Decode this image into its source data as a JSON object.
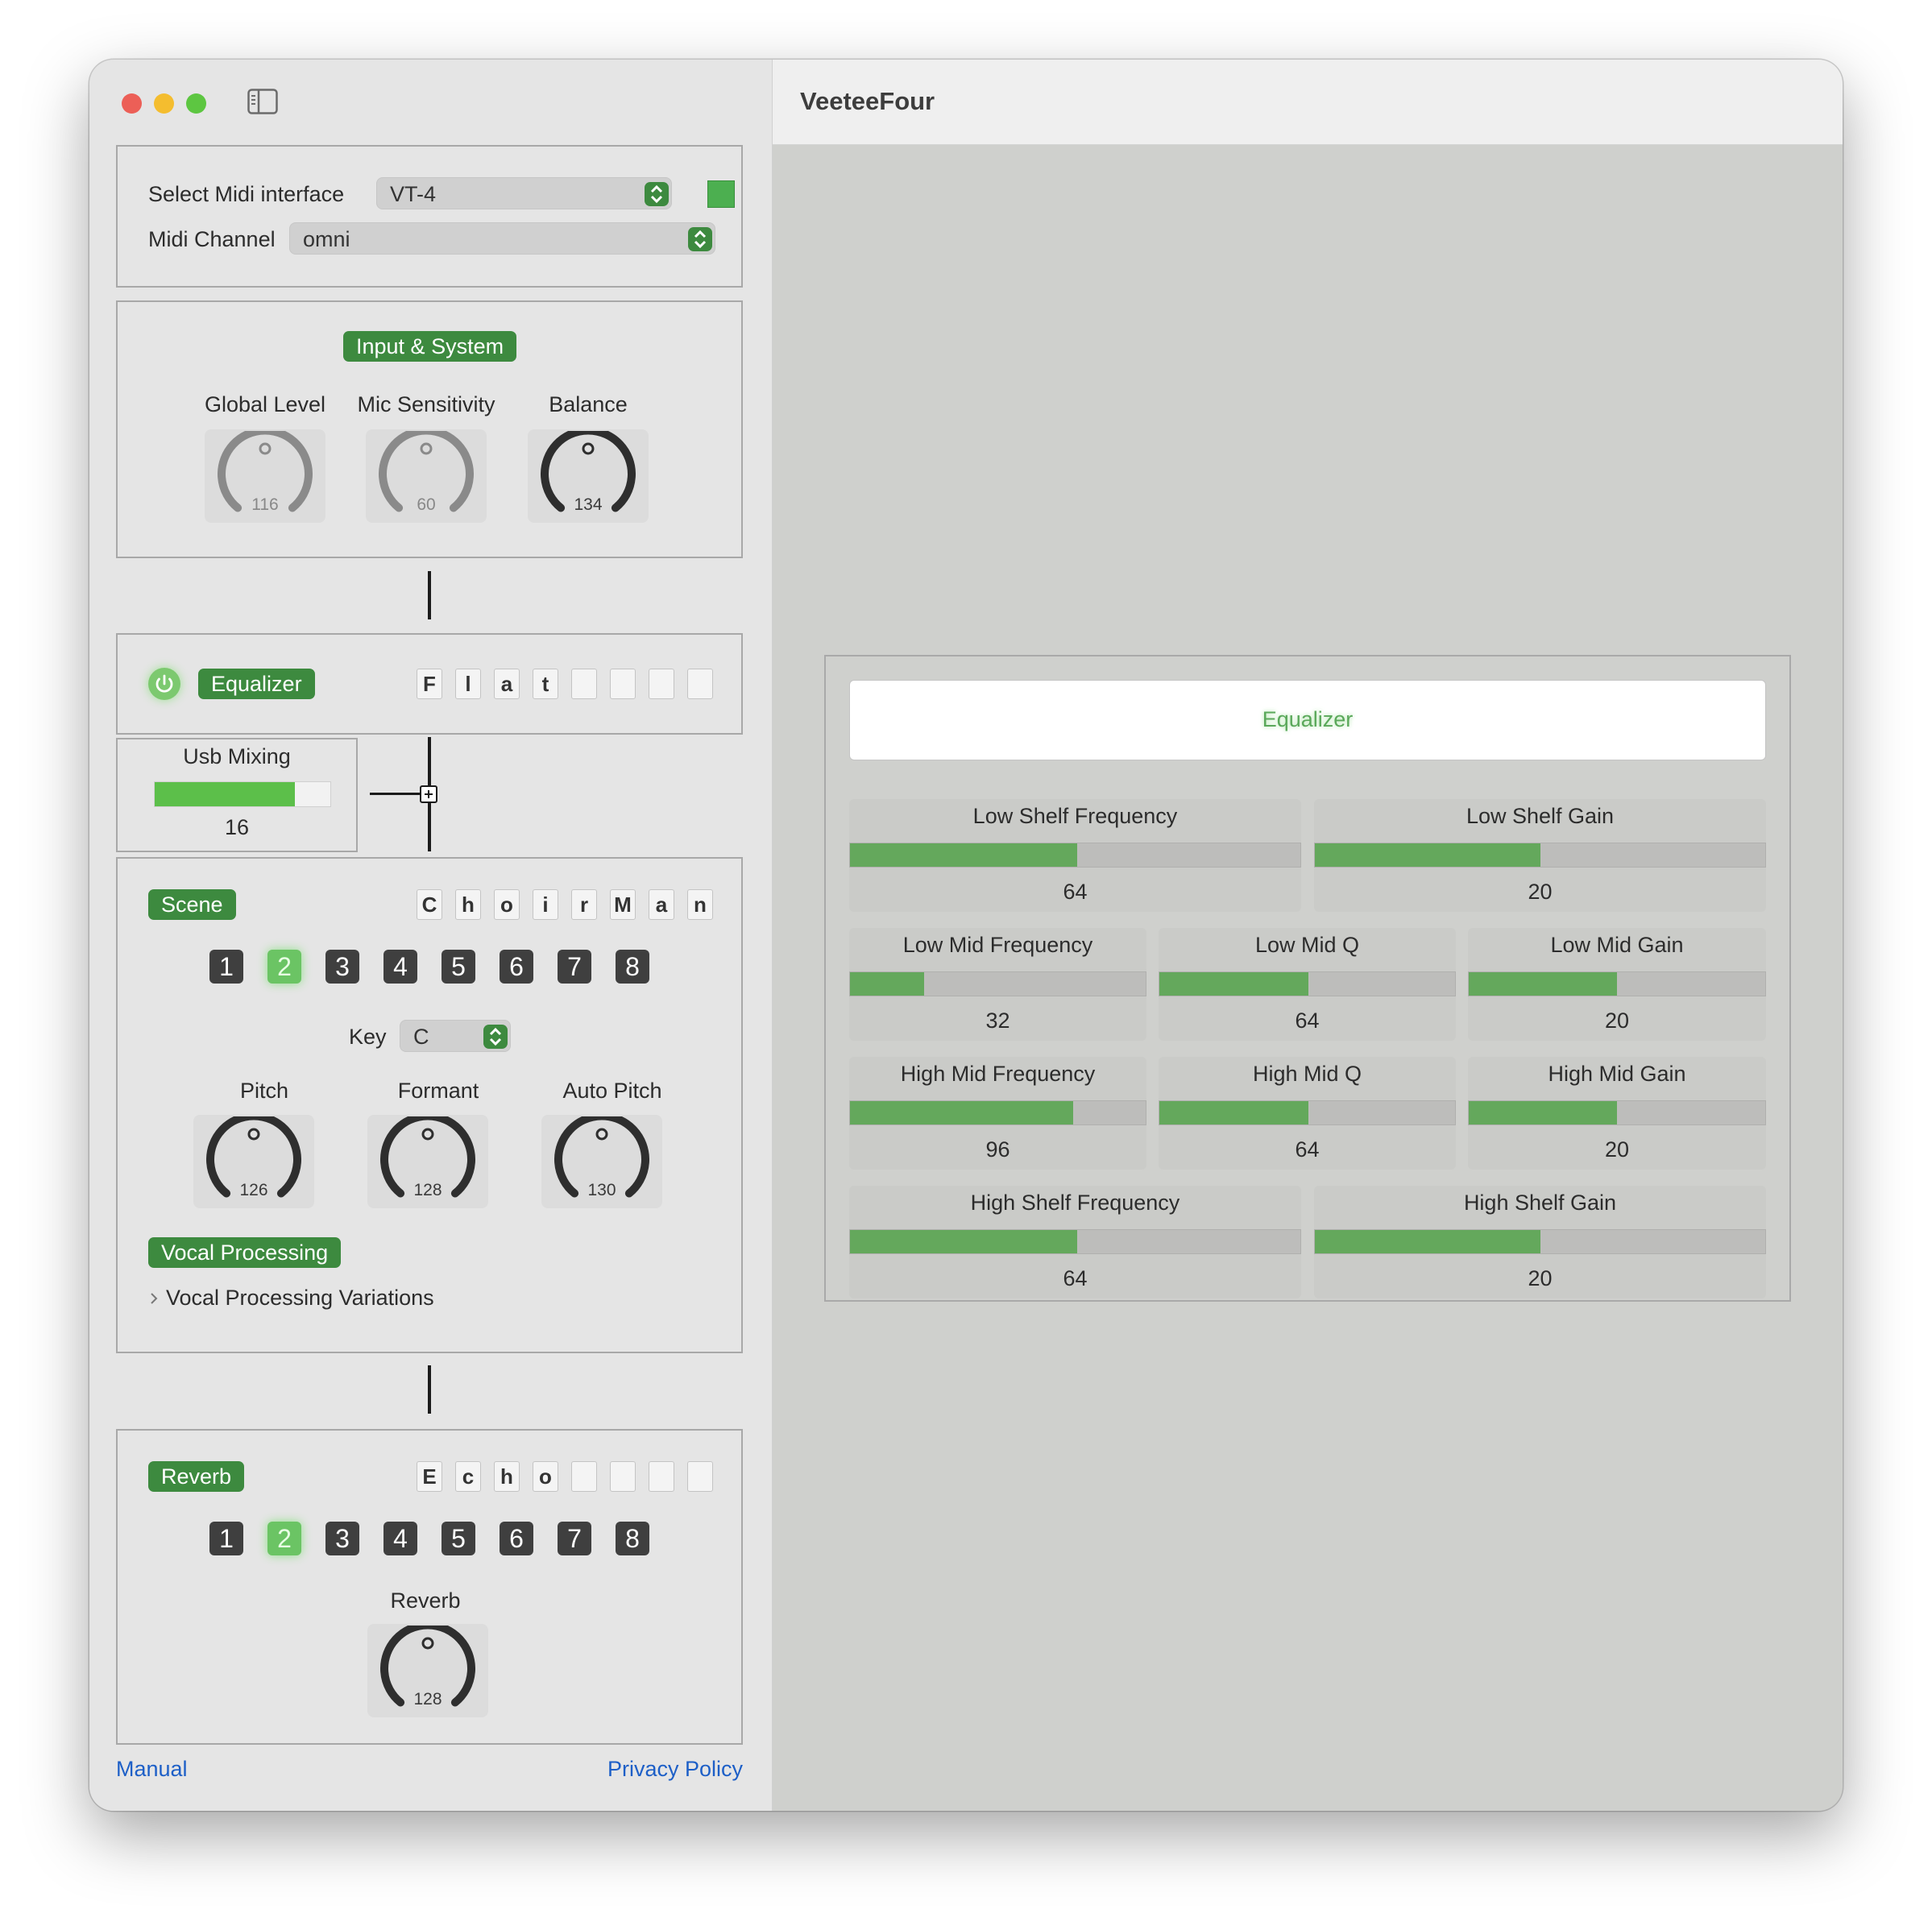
{
  "window": {
    "title": "VeeteeFour"
  },
  "midi": {
    "interface_label": "Select Midi interface",
    "interface_value": "VT-4",
    "channel_label": "Midi Channel",
    "channel_value": "omni",
    "status_color": "#4caf50"
  },
  "input_system": {
    "title": "Input & System",
    "knobs": [
      {
        "label": "Global Level",
        "value": "116",
        "enabled": false
      },
      {
        "label": "Mic Sensitivity",
        "value": "60",
        "enabled": false
      },
      {
        "label": "Balance",
        "value": "134",
        "enabled": true
      }
    ]
  },
  "equalizer_section": {
    "power": "on",
    "title": "Equalizer",
    "preset_chars": [
      "F",
      "l",
      "a",
      "t",
      "",
      "",
      "",
      ""
    ]
  },
  "usb_mixing": {
    "label": "Usb Mixing",
    "value": "16",
    "level_fraction": 0.8
  },
  "scene": {
    "title": "Scene",
    "name_chars": [
      "C",
      "h",
      "o",
      "i",
      "r",
      "M",
      "a",
      "n"
    ],
    "buttons": [
      "1",
      "2",
      "3",
      "4",
      "5",
      "6",
      "7",
      "8"
    ],
    "active": "2",
    "key_label": "Key",
    "key_value": "C",
    "knobs": [
      {
        "label": "Pitch",
        "value": "126"
      },
      {
        "label": "Formant",
        "value": "128"
      },
      {
        "label": "Auto Pitch",
        "value": "130"
      }
    ],
    "vocal_processing": "Vocal Processing",
    "variations": "Vocal Processing Variations"
  },
  "reverb": {
    "title": "Reverb",
    "name_chars": [
      "E",
      "c",
      "h",
      "o",
      "",
      "",
      "",
      ""
    ],
    "buttons": [
      "1",
      "2",
      "3",
      "4",
      "5",
      "6",
      "7",
      "8"
    ],
    "active": "2",
    "knob": {
      "label": "Reverb",
      "value": "128"
    }
  },
  "links": {
    "manual": "Manual",
    "privacy": "Privacy Policy"
  },
  "eq_detail": {
    "header": "Equalizer",
    "rows": [
      [
        {
          "label": "Low Shelf Frequency",
          "value": "64",
          "fraction": 0.504
        },
        {
          "label": "Low Shelf Gain",
          "value": "20",
          "fraction": 0.5
        }
      ],
      [
        {
          "label": "Low Mid Frequency",
          "value": "32",
          "fraction": 0.25
        },
        {
          "label": "Low Mid Q",
          "value": "64",
          "fraction": 0.504
        },
        {
          "label": "Low Mid Gain",
          "value": "20",
          "fraction": 0.5
        }
      ],
      [
        {
          "label": "High Mid Frequency",
          "value": "96",
          "fraction": 0.756
        },
        {
          "label": "High Mid Q",
          "value": "64",
          "fraction": 0.504
        },
        {
          "label": "High Mid Gain",
          "value": "20",
          "fraction": 0.5
        }
      ],
      [
        {
          "label": "High Shelf Frequency",
          "value": "64",
          "fraction": 0.504
        },
        {
          "label": "High Shelf Gain",
          "value": "20",
          "fraction": 0.5
        }
      ]
    ]
  },
  "colors": {
    "accent_green": "#3d8a3f",
    "fill_green": "#64a85c",
    "active_green": "#6bc464",
    "link_blue": "#1d5fc7"
  }
}
